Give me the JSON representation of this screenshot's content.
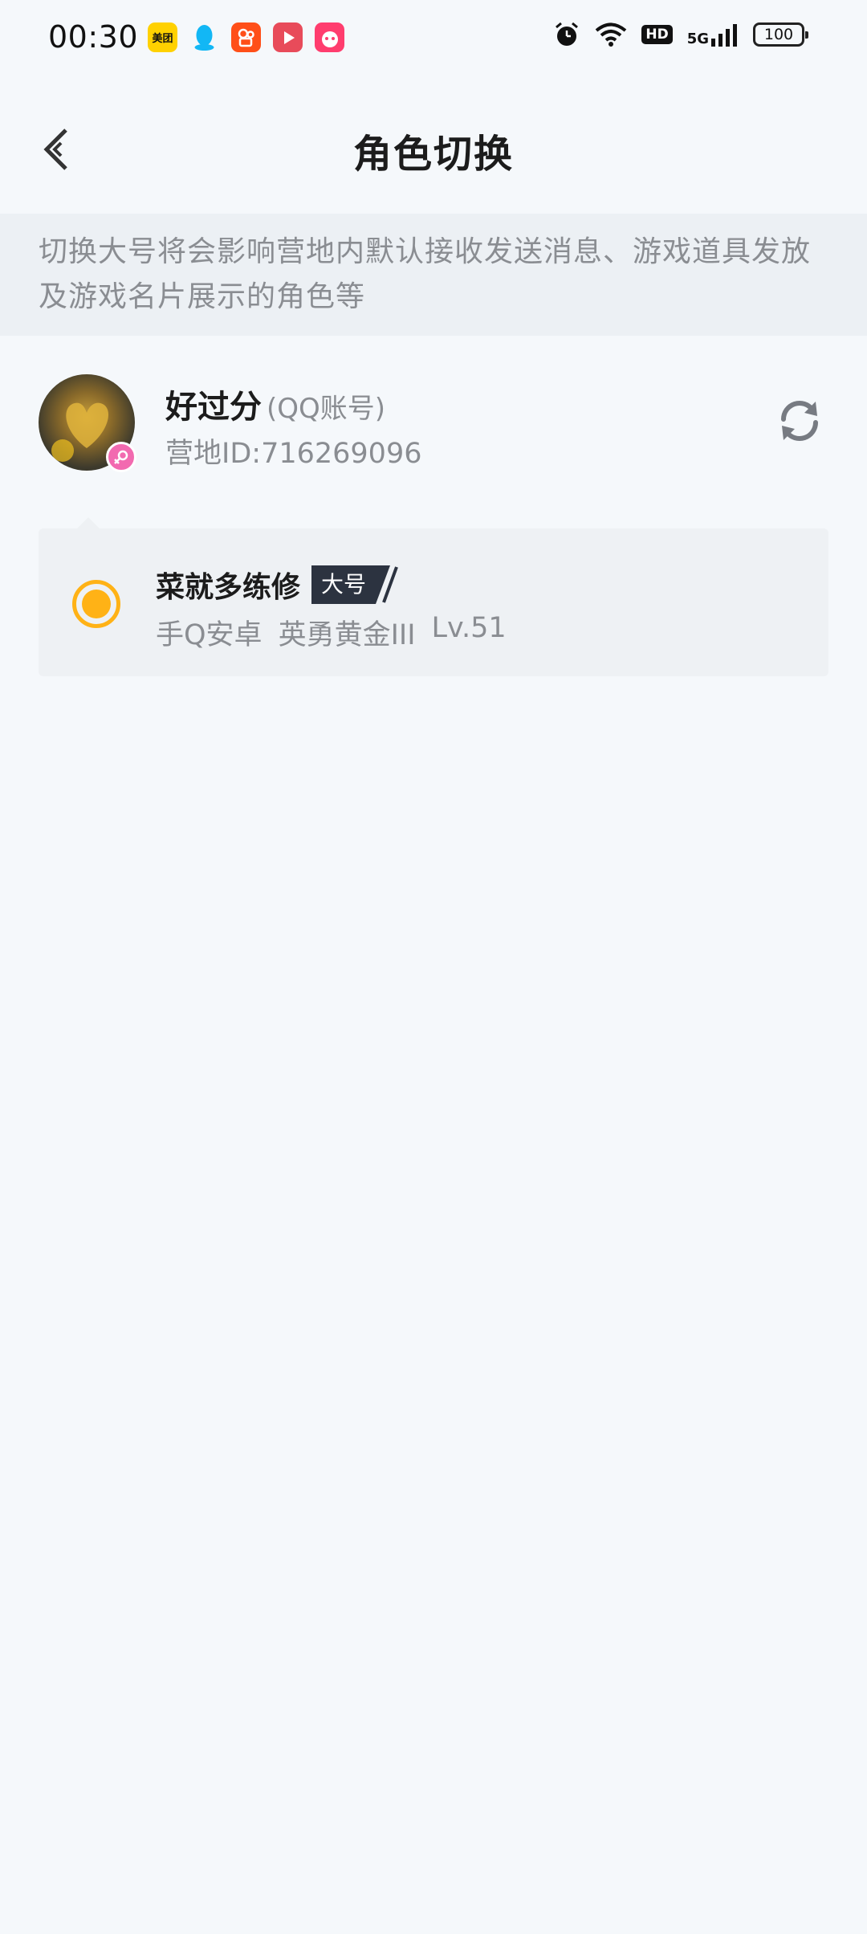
{
  "status_bar": {
    "time": "00:30",
    "app_icons": [
      "meituan-icon",
      "qq-icon",
      "kuaishou-icon",
      "video-icon",
      "taobao-618-icon"
    ],
    "meituan_label": "美团",
    "hd_label": "HD",
    "network_label": "5G",
    "battery_level": "100"
  },
  "header": {
    "title": "角色切换"
  },
  "notice": {
    "text": "切换大号将会影响营地内默认接收发送消息、游戏道具发放及游戏名片展示的角色等"
  },
  "account": {
    "name": "好过分",
    "type": "(QQ账号)",
    "camp_id": "营地ID:716269096"
  },
  "roles": [
    {
      "name": "菜就多练修",
      "tag": "大号",
      "platform": "手Q安卓",
      "rank": "英勇黄金III",
      "level": "Lv.51",
      "selected": true
    }
  ],
  "colors": {
    "background": "#f5f8fb",
    "notice_bg": "#ecf0f4",
    "accent": "#ffb216",
    "tag_bg": "#2c3340",
    "secondary_text": "#8a8d92",
    "gender_badge": "#f26ab0"
  }
}
